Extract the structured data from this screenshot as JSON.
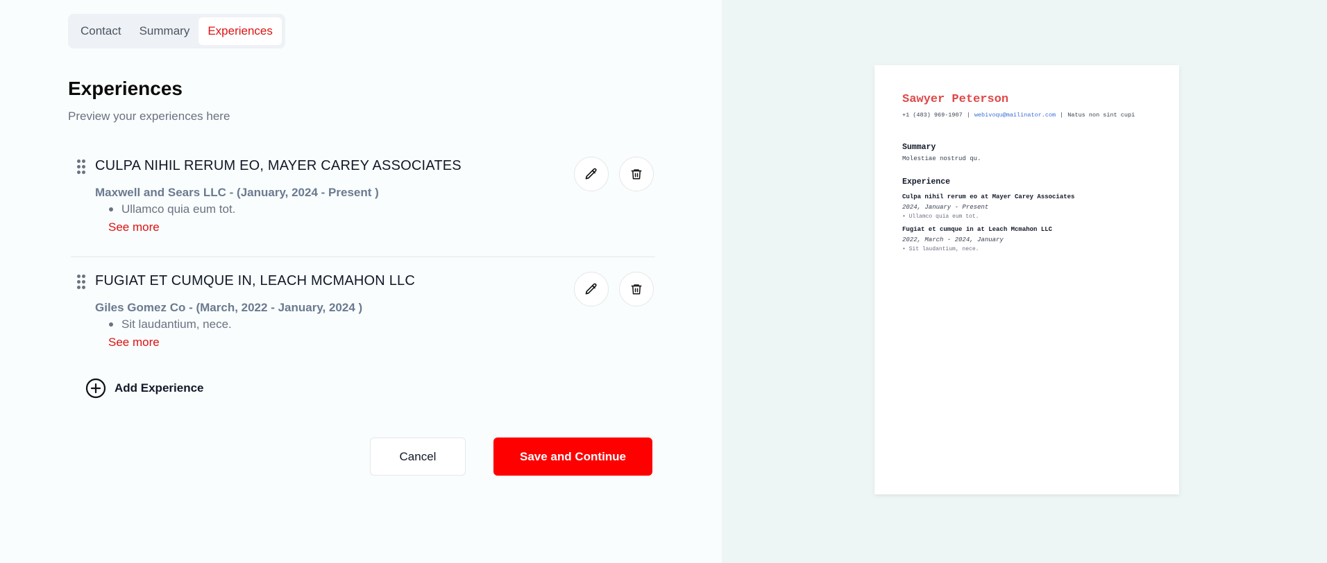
{
  "tabs": [
    {
      "label": "Contact",
      "active": false
    },
    {
      "label": "Summary",
      "active": false
    },
    {
      "label": "Experiences",
      "active": true
    }
  ],
  "page": {
    "title": "Experiences",
    "subtitle": "Preview your experiences here"
  },
  "experiences": [
    {
      "title": "CULPA NIHIL RERUM EO, MAYER CAREY ASSOCIATES",
      "meta": "Maxwell and Sears LLC - (January, 2024 - Present )",
      "bullet": "Ullamco quia eum tot.",
      "see_more": "See more"
    },
    {
      "title": "FUGIAT ET CUMQUE IN, LEACH MCMAHON LLC",
      "meta": "Giles Gomez Co - (March, 2022 - January, 2024 )",
      "bullet": "Sit laudantium, nece.",
      "see_more": "See more"
    }
  ],
  "actions": {
    "add_experience": "Add Experience",
    "cancel": "Cancel",
    "save": "Save and Continue"
  },
  "resume": {
    "name": "Sawyer Peterson",
    "phone": "+1 (483) 969-1907",
    "email": "webivoqu@mailinator.com",
    "location": "Natus non sint cupi",
    "summary_heading": "Summary",
    "summary_text": "Molestiae nostrud qu.",
    "experience_heading": "Experience",
    "jobs": [
      {
        "title": "Culpa nihil rerum eo at Mayer Carey Associates",
        "dates": "2024, January - Present",
        "bullet": "Ullamco quia eum tot."
      },
      {
        "title": "Fugiat et cumque in at Leach Mcmahon LLC",
        "dates": "2022, March - 2024, January",
        "bullet": "Sit laudantium, nece."
      }
    ]
  },
  "colors": {
    "accent": "#ff0000",
    "active_tab": "#dd1111",
    "resume_name": "#e04848",
    "resume_email": "#3b6fd8"
  }
}
